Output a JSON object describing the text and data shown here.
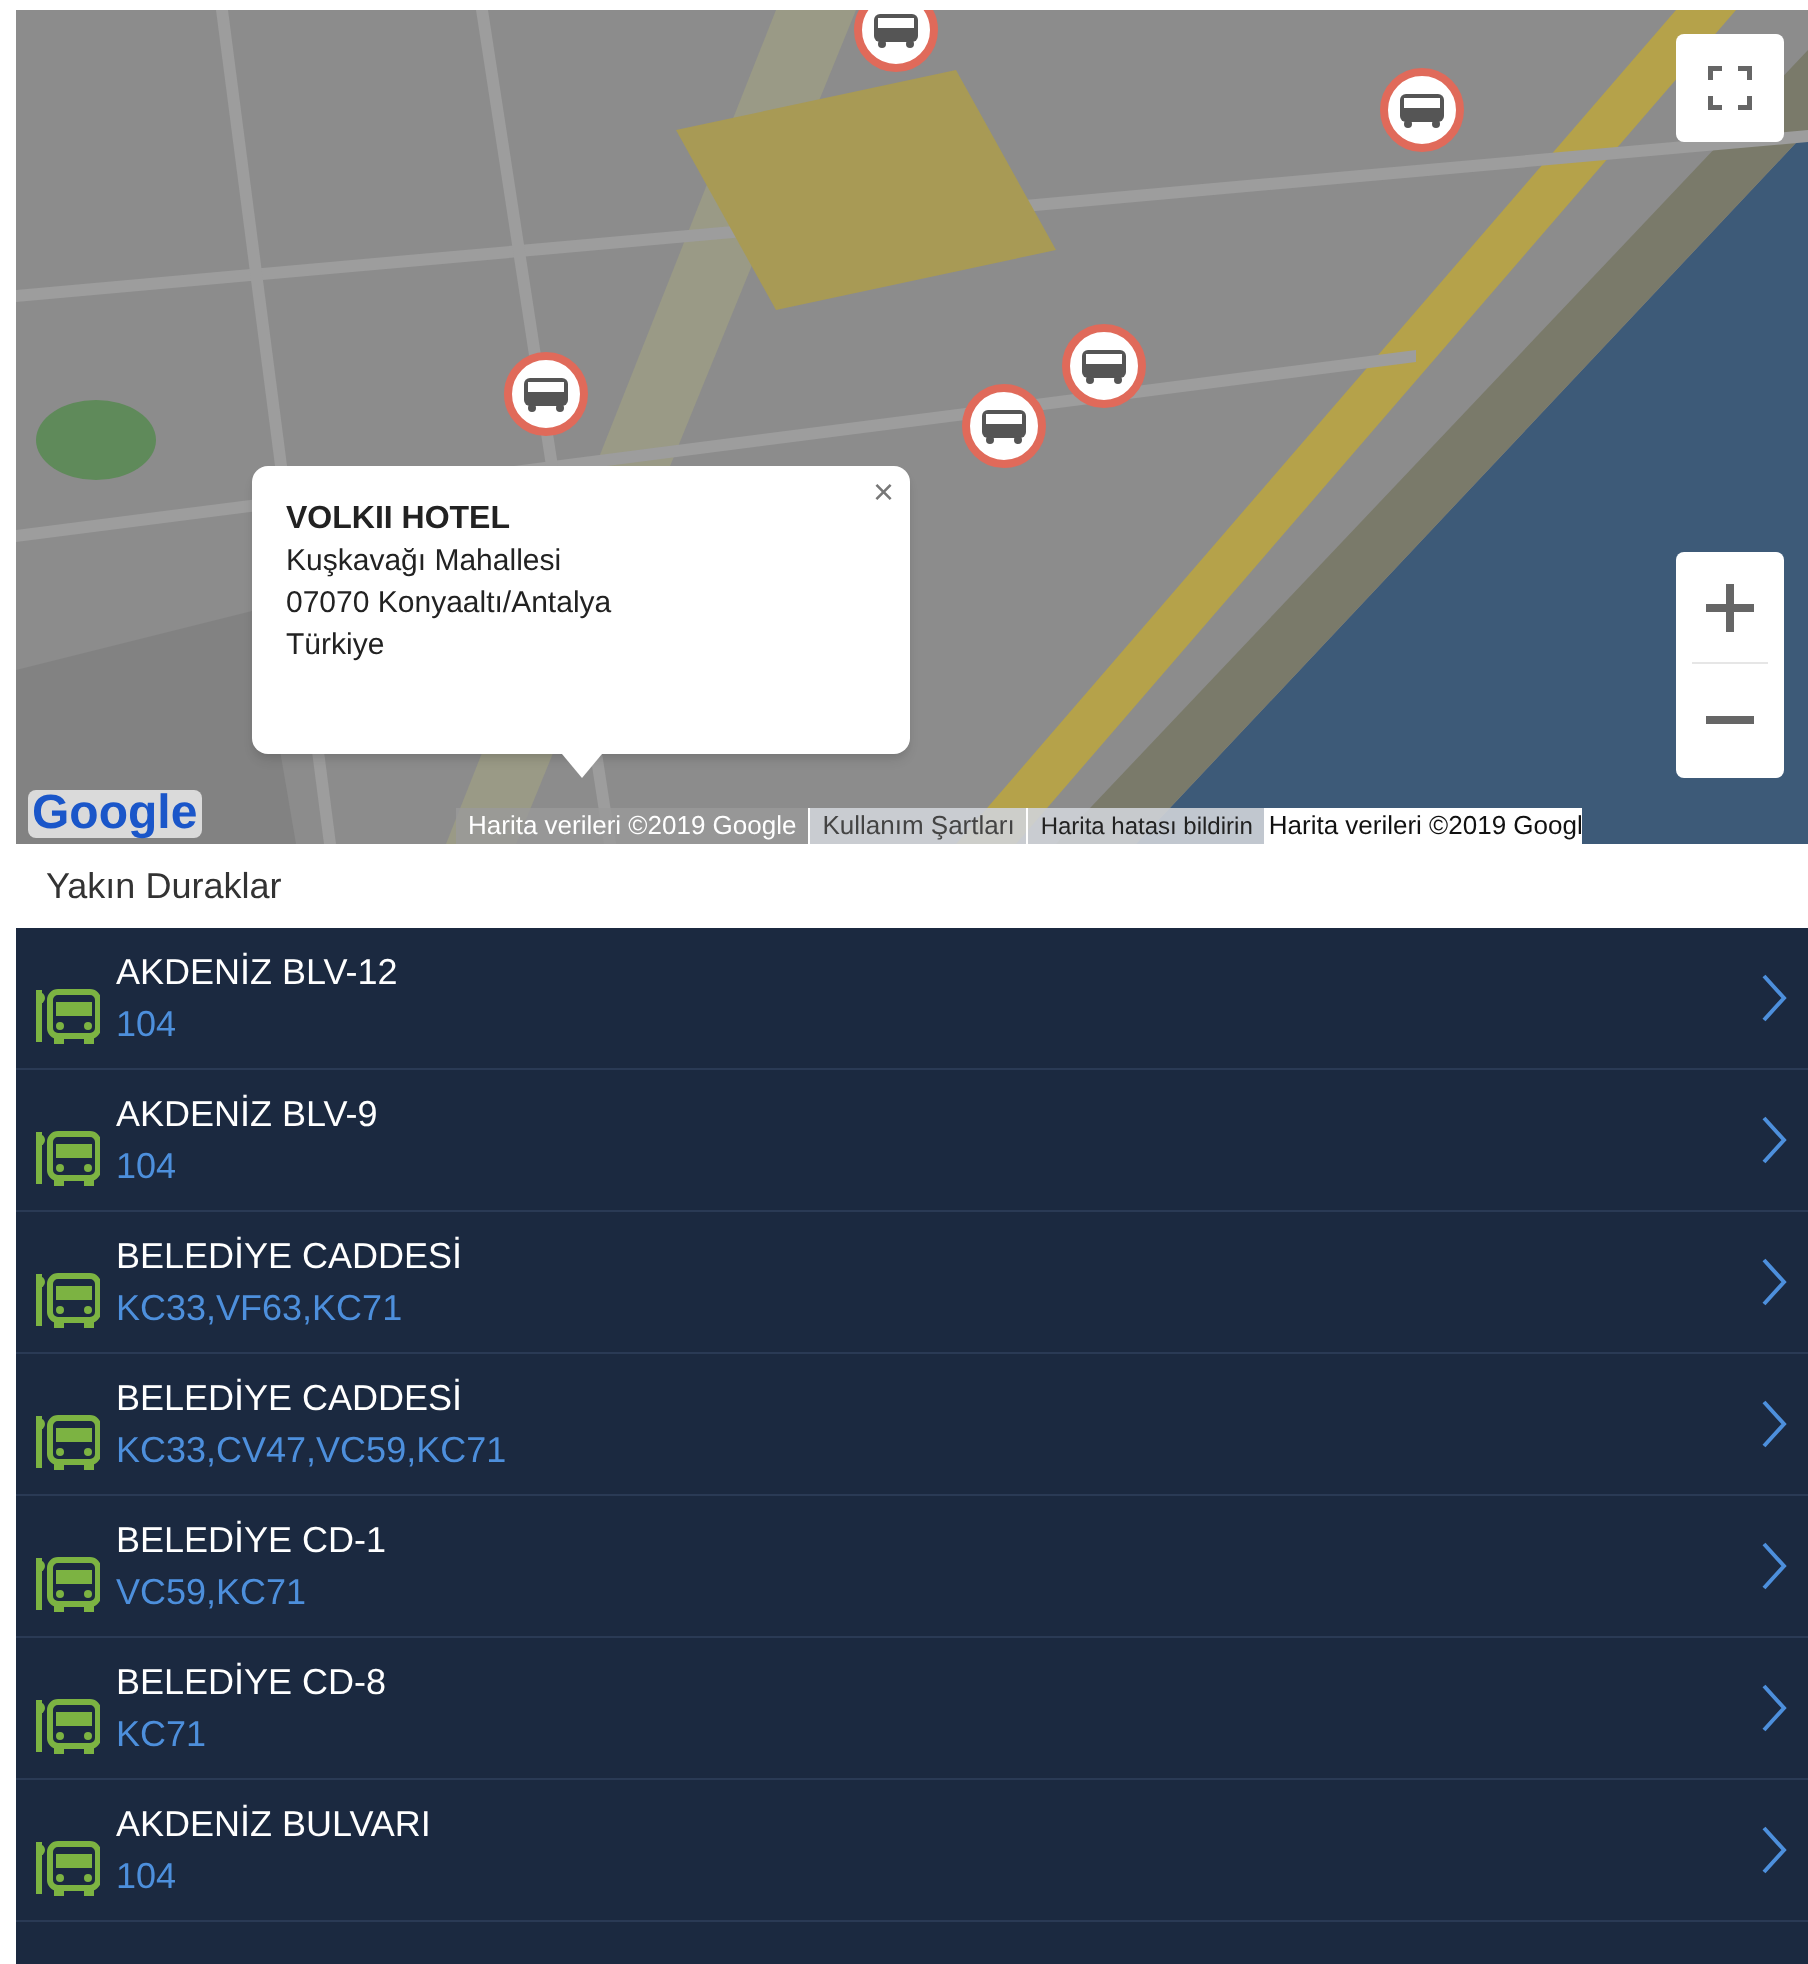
{
  "map": {
    "markers": [
      {
        "kind": "bus"
      },
      {
        "kind": "bus"
      },
      {
        "kind": "bus"
      },
      {
        "kind": "bus"
      },
      {
        "kind": "bus"
      }
    ],
    "info_window": {
      "title": "VOLKII HOTEL",
      "lines": [
        "Kuşkavağı Mahallesi",
        "07070 Konyaaltı/Antalya",
        "Türkiye"
      ],
      "close": "×"
    },
    "logo": "Google",
    "attribution": [
      "Harita verileri ©2019 Google",
      "Kullanım Şartları",
      "Harita hatası bildirin",
      "Harita verileri ©2019 Googl"
    ]
  },
  "section_title": "Yakın Duraklar",
  "stops": [
    {
      "name": "AKDENİZ BLV-12",
      "routes": "104"
    },
    {
      "name": "AKDENİZ BLV-9",
      "routes": "104"
    },
    {
      "name": "BELEDİYE CADDESİ",
      "routes": "KC33,VF63,KC71"
    },
    {
      "name": "BELEDİYE CADDESİ",
      "routes": "KC33,CV47,VC59,KC71"
    },
    {
      "name": "BELEDİYE CD-1",
      "routes": "VC59,KC71"
    },
    {
      "name": "BELEDİYE CD-8",
      "routes": "KC71"
    },
    {
      "name": "AKDENİZ BULVARI",
      "routes": "104"
    }
  ]
}
